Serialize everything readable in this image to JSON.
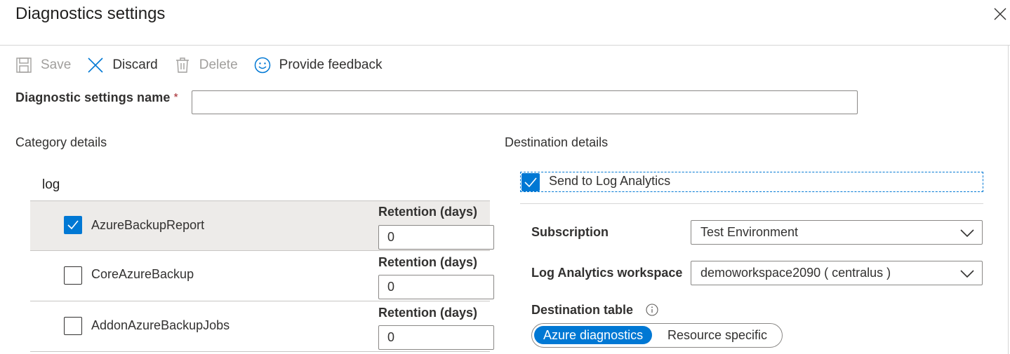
{
  "panel": {
    "title": "Diagnostics settings"
  },
  "toolbar": {
    "save": "Save",
    "discard": "Discard",
    "delete": "Delete",
    "feedback": "Provide feedback"
  },
  "name_field": {
    "label": "Diagnostic settings name",
    "required_marker": "*",
    "value": ""
  },
  "category": {
    "heading": "Category details",
    "group_title": "log",
    "retention_label": "Retention (days)",
    "rows": [
      {
        "name": "AzureBackupReport",
        "checked": true,
        "retention": "0"
      },
      {
        "name": "CoreAzureBackup",
        "checked": false,
        "retention": "0"
      },
      {
        "name": "AddonAzureBackupJobs",
        "checked": false,
        "retention": "0"
      }
    ]
  },
  "destination": {
    "heading": "Destination details",
    "send_to_log_analytics": {
      "label": "Send to Log Analytics",
      "checked": true
    },
    "subscription": {
      "label": "Subscription",
      "value": "Test Environment"
    },
    "workspace": {
      "label": "Log Analytics workspace",
      "value": "demoworkspace2090 ( centralus )"
    },
    "table": {
      "label": "Destination table",
      "options": [
        "Azure diagnostics",
        "Resource specific"
      ],
      "selected": "Azure diagnostics"
    }
  },
  "colors": {
    "accent": "#0078d4",
    "required": "#a4262c",
    "selected_row": "#edebe9"
  }
}
